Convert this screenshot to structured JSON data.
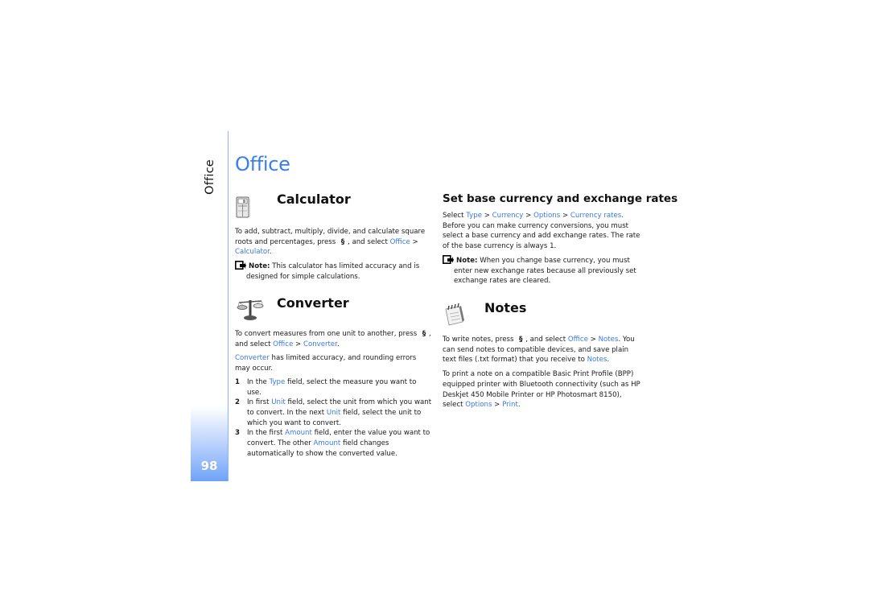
{
  "page": {
    "side_label": "Office",
    "page_number": "98",
    "title": "Office",
    "accent_color": "#3b7ef0"
  },
  "calculator": {
    "heading": "Calculator",
    "icon": "calculator-icon",
    "para1": {
      "t1": "To add, subtract, multiply, divide, and calculate square roots and percentages, press ",
      "t2": ", and select ",
      "l1": "Office",
      "t3": " > ",
      "l2": "Calculator",
      "t4": "."
    },
    "note": {
      "label": "Note:",
      "text": " This calculator has limited accuracy and is designed for simple calculations."
    }
  },
  "converter": {
    "heading": "Converter",
    "icon": "scales-icon",
    "para1": {
      "t1": "To convert measures from one unit to another, press ",
      "t2": ", and select ",
      "l1": "Office",
      "t3": " > ",
      "l2": "Converter",
      "t4": "."
    },
    "para2": {
      "l1": "Converter",
      "t1": " has limited accuracy, and rounding errors may occur."
    },
    "steps": [
      {
        "num": "1",
        "t1": "In the ",
        "l1": "Type",
        "t2": " field, select the measure you want to use."
      },
      {
        "num": "2",
        "t1": "In first ",
        "l1": "Unit",
        "t2": " field, select the unit from which you want to convert. In the next ",
        "l2": "Unit",
        "t3": " field, select the unit to which you want to convert."
      },
      {
        "num": "3",
        "t1": "In the first ",
        "l1": "Amount",
        "t2": " field, enter the value you want to convert. The other ",
        "l2": "Amount",
        "t3": " field changes automatically to show the converted value."
      }
    ]
  },
  "currency": {
    "heading": "Set base currency and exchange rates",
    "para1": {
      "t1": "Select ",
      "l1": "Type",
      "s1": " > ",
      "l2": "Currency",
      "s2": " > ",
      "l3": "Options",
      "s3": " > ",
      "l4": "Currency rates",
      "t2": ". Before you can make currency conversions, you must select a base currency and add exchange rates. The rate of the base currency is always 1."
    },
    "note": {
      "label": "Note:",
      "text": " When you change base currency, you must enter new exchange rates because all previously set exchange rates are cleared."
    }
  },
  "notes": {
    "heading": "Notes",
    "icon": "notepad-icon",
    "para1": {
      "t1": "To write notes, press ",
      "t2": ", and select ",
      "l1": "Office",
      "t3": " > ",
      "l2": "Notes",
      "t4": ". You can send notes to compatible devices, and save plain text files (.txt format) that you receive to ",
      "l3": "Notes",
      "t5": "."
    },
    "para2": {
      "t1": "To print a note on a compatible Basic Print Profile (BPP) equipped printer with Bluetooth connectivity (such as HP Deskjet 450 Mobile Printer or HP Photosmart 8150), select ",
      "l1": "Options",
      "t2": " > ",
      "l2": "Print",
      "t3": "."
    }
  },
  "menu_key_glyph": "§"
}
